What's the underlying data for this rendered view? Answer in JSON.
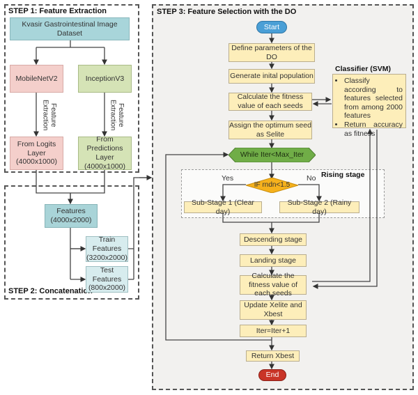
{
  "step1": {
    "title": "STEP 1: Feature Extraction",
    "dataset": "Kvasir Gastrointestinal Image Dataset",
    "model_a": "MobileNetV2",
    "model_b": "InceptionV3",
    "edge_label_a": "Feature Extraction",
    "edge_label_b": "Feature Extraction",
    "output_a": "From Logits Layer (4000x1000)",
    "output_b": "From Predictions Layer (4000x1000)"
  },
  "step2": {
    "title": "STEP 2: Concatenation",
    "features": "Features (4000x2000)",
    "train": "Train Features (3200x2000)",
    "test": "Test Features (800x2000)"
  },
  "step3": {
    "title": "STEP 3: Feature Selection with the DO",
    "start": "Start",
    "define": "Define parameters of the DO",
    "generate": "Generate inital population",
    "calc1": "Calculate the fitness value of each seeds",
    "assign": "Assign the optimum seed as Selite",
    "while": "While Iter<Max_Iter",
    "rising_label": "Rising stage",
    "decision": "IF rndn<1.5",
    "yes": "Yes",
    "no": "No",
    "sub1": "Sub-Stage 1 (Clear day)",
    "sub2": "Sub-Stage 2 (Rainy day)",
    "descending": "Descending stage",
    "landing": "Landing stage",
    "calc2": "Calculate the fitness value of each seeds",
    "update": "Update Xelite and Xbest",
    "iter": "Iter=Iter+1",
    "ret": "Return Xbest",
    "end": "End"
  },
  "classifier": {
    "title": "Classifier (SVM)",
    "items": [
      "Classify according to features selected from among 2000 features",
      "Return accuracy as fitness"
    ]
  },
  "colors": {
    "start": "#4a9fd6",
    "end": "#c93427",
    "while": "#70ad47",
    "decision": "#f5b11c",
    "process": "#fdeeba",
    "dataset": "#a8d5da",
    "mobilenet": "#f4cfcb",
    "inception": "#d5e3b6"
  }
}
